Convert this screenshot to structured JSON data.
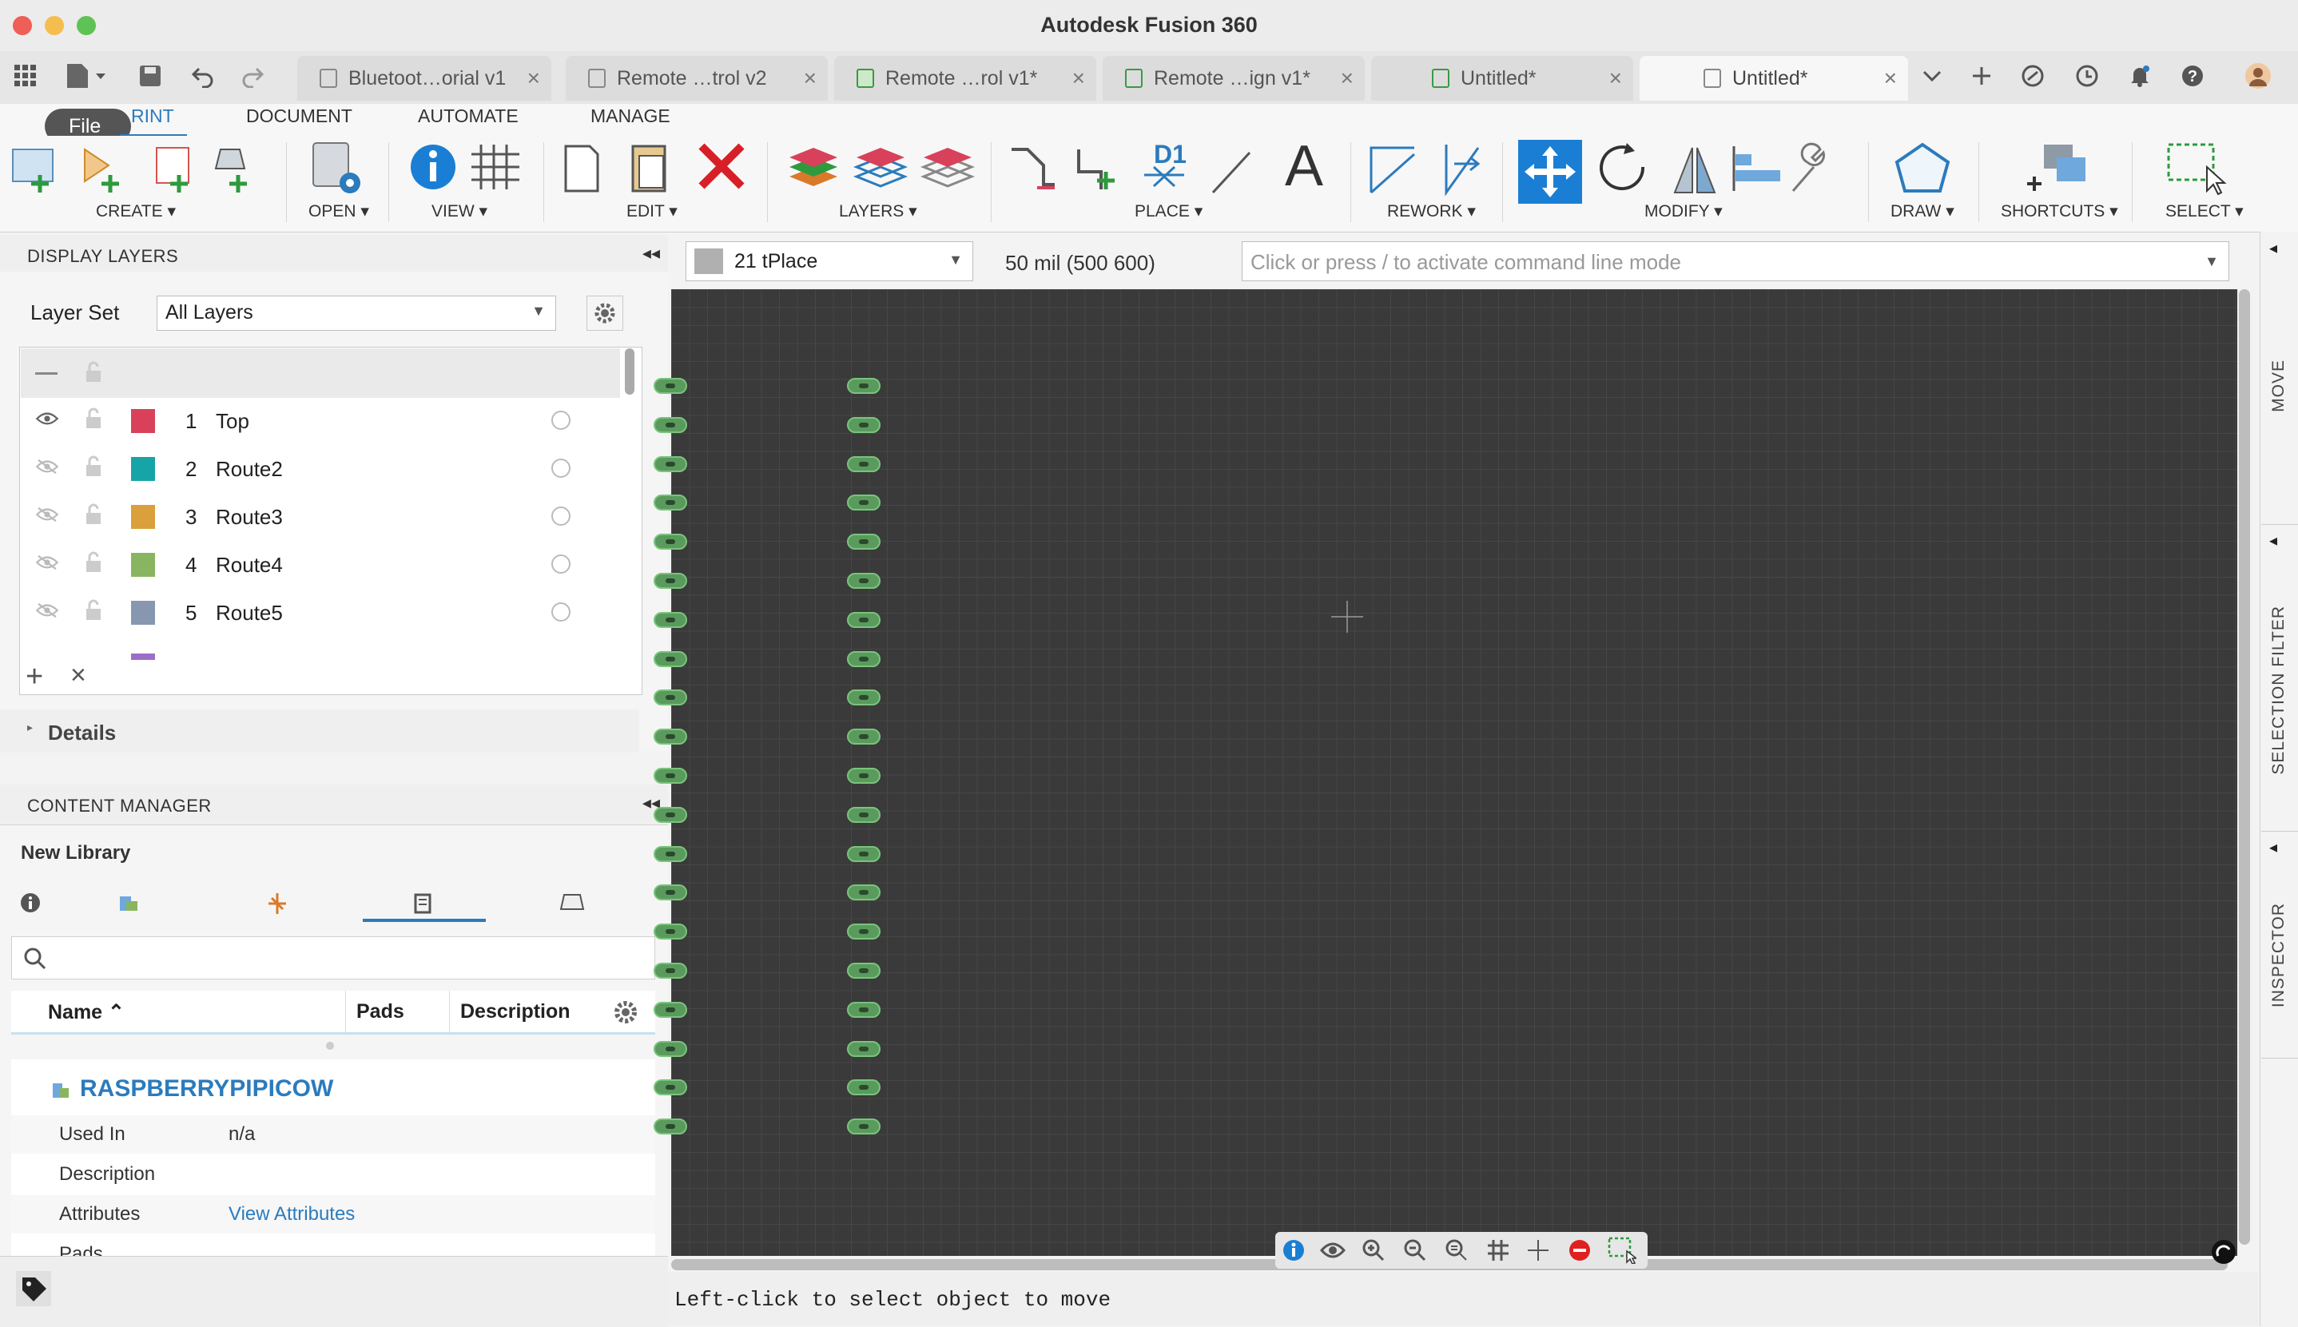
{
  "window": {
    "title": "Autodesk Fusion 360"
  },
  "tabs": [
    {
      "label": "Bluetoot…orial v1",
      "icon": "cube-icon"
    },
    {
      "label": "Remote …trol v2",
      "icon": "cube-icon"
    },
    {
      "label": "Remote …rol v1*",
      "icon": "pcb-icon"
    },
    {
      "label": "Remote …ign v1*",
      "icon": "schematic-icon"
    },
    {
      "label": "Untitled*",
      "icon": "schematic-icon"
    },
    {
      "label": "Untitled*",
      "icon": "document-icon"
    }
  ],
  "ribbon": {
    "tooltip": "File",
    "tabs": [
      "RINT",
      "DOCUMENT",
      "AUTOMATE",
      "MANAGE"
    ],
    "groups": {
      "create": "CREATE",
      "open": "OPEN",
      "view": "VIEW",
      "edit": "EDIT",
      "layers": "LAYERS",
      "place": "PLACE",
      "rework": "REWORK",
      "modify": "MODIFY",
      "draw": "DRAW",
      "shortcuts": "SHORTCUTS",
      "select": "SELECT"
    },
    "place_d1": "D1",
    "place_text": "A"
  },
  "display_layers": {
    "header": "DISPLAY LAYERS",
    "layer_set_label": "Layer Set",
    "layer_set_value": "All Layers",
    "rows": [
      {
        "num": "1",
        "name": "Top",
        "color": "#d9415a",
        "visible": true
      },
      {
        "num": "2",
        "name": "Route2",
        "color": "#17a4a8",
        "visible": false
      },
      {
        "num": "3",
        "name": "Route3",
        "color": "#d9a03b",
        "visible": false
      },
      {
        "num": "4",
        "name": "Route4",
        "color": "#8ab560",
        "visible": false
      },
      {
        "num": "5",
        "name": "Route5",
        "color": "#8797b0",
        "visible": false
      }
    ],
    "details_label": "Details"
  },
  "canvas_toolbar": {
    "layer_value": "21 tPlace",
    "grid_size": "50 mil (500 600)",
    "command_placeholder": "Click or press / to activate command line mode"
  },
  "content_manager": {
    "header": "CONTENT MANAGER",
    "library": "New Library",
    "columns": {
      "name": "Name",
      "pads": "Pads",
      "description": "Description"
    },
    "item": {
      "title": "RASPBERRYPIPICOW",
      "used_in_label": "Used In",
      "used_in_value": "n/a",
      "description_label": "Description",
      "attributes_label": "Attributes",
      "attributes_link": "View Attributes",
      "pads_label": "Pads"
    }
  },
  "side_panels": {
    "move": "MOVE",
    "selection_filter": "SELECTION FILTER",
    "inspector": "INSPECTOR"
  },
  "status": {
    "message": "Left-click to select object to move"
  },
  "pads": {
    "rows": 20,
    "columns": 2
  }
}
